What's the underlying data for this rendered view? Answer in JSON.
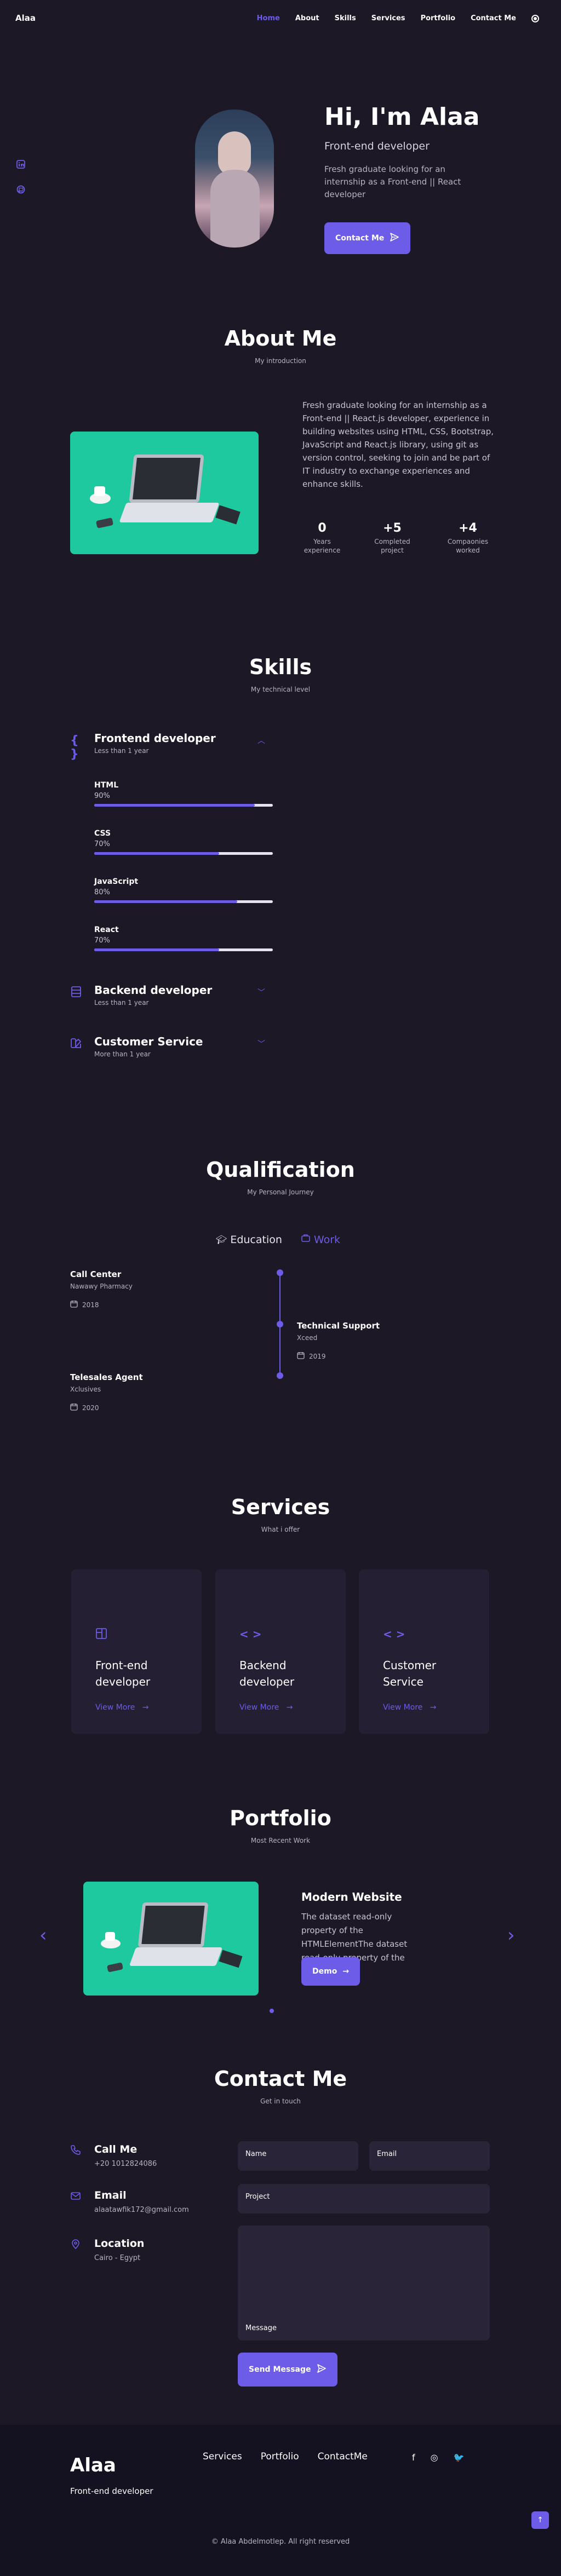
{
  "header": {
    "logo": "Alaa",
    "nav": [
      "Home",
      "About",
      "Skills",
      "Services",
      "Portfolio",
      "Contact Me"
    ],
    "active": "Home"
  },
  "hero": {
    "title": "Hi, I'm Alaa",
    "subtitle": "Front-end developer",
    "description": "Fresh graduate looking for an internship as a Front-end || React developer",
    "button": "Contact Me"
  },
  "about": {
    "title": "About Me",
    "subtitle": "My introduction",
    "description": "Fresh graduate looking for an internship as a Front-end || React.js developer, experience in building websites using HTML, CSS, Bootstrap, JavaScript and React.js library, using git as version control, seeking to join and be part of IT industry to exchange experiences and enhance skills.",
    "stats": [
      {
        "value": "0",
        "label": "Years experience"
      },
      {
        "value": "+5",
        "label": "Completed project"
      },
      {
        "value": "+4",
        "label": "Compaonies worked"
      }
    ]
  },
  "skills": {
    "title": "Skills",
    "subtitle": "My technical level",
    "groups": [
      {
        "title": "Frontend developer",
        "sub": "Less than 1 year"
      },
      {
        "title": "Backend developer",
        "sub": "Less than 1 year"
      },
      {
        "title": "Customer Service",
        "sub": "More than 1 year"
      }
    ],
    "frontend": [
      {
        "name": "HTML",
        "pct": "90%",
        "level": 0.9
      },
      {
        "name": "CSS",
        "pct": "70%",
        "level": 0.7
      },
      {
        "name": "JavaScript",
        "pct": "80%",
        "level": 0.8
      },
      {
        "name": "React",
        "pct": "70%",
        "level": 0.7
      }
    ]
  },
  "qualification": {
    "title": "Qualification",
    "subtitle": "My Personal Journey",
    "tabs": [
      "Education",
      "Work"
    ],
    "items": [
      {
        "title": "Call Center",
        "org": "Nawawy Pharmacy",
        "date": "2018"
      },
      {
        "title": "Technical Support",
        "org": "Xceed",
        "date": "2019"
      },
      {
        "title": "Telesales Agent",
        "org": "Xclusives",
        "date": "2020"
      }
    ]
  },
  "services": {
    "title": "Services",
    "subtitle": "What i offer",
    "cards": [
      {
        "title": "Front-end developer",
        "link": "View More"
      },
      {
        "title": "Backend developer",
        "link": "View More"
      },
      {
        "title": "Customer Service",
        "link": "View More"
      }
    ]
  },
  "portfolio": {
    "title": "Portfolio",
    "subtitle": "Most Recent Work",
    "project_title": "Modern Website",
    "project_desc": "The dataset read-only property of the HTMLElementThe dataset read-only property of the HTMLElement",
    "button": "Demo"
  },
  "contact": {
    "title": "Contact Me",
    "subtitle": "Get in touch",
    "info": [
      {
        "label": "Call Me",
        "value": "+20 1012824086"
      },
      {
        "label": "Email",
        "value": "alaatawfik172@gmail.com"
      },
      {
        "label": "Location",
        "value": "Cairo - Egypt"
      }
    ],
    "fields": {
      "name": "Name",
      "email": "Email",
      "project": "Project",
      "message": "Message"
    },
    "button": "Send Message"
  },
  "footer": {
    "logo": "Alaa",
    "sub": "Front-end developer",
    "links": [
      "Services",
      "Portfolio",
      "ContactMe"
    ],
    "social": [
      "f",
      "◎",
      "🐦"
    ],
    "copyright": "© Alaa Abdelmotlep. All right reserved"
  },
  "colors": {
    "accent": "#6c5ce7",
    "background": "#1c1826",
    "card": "#251f34"
  }
}
